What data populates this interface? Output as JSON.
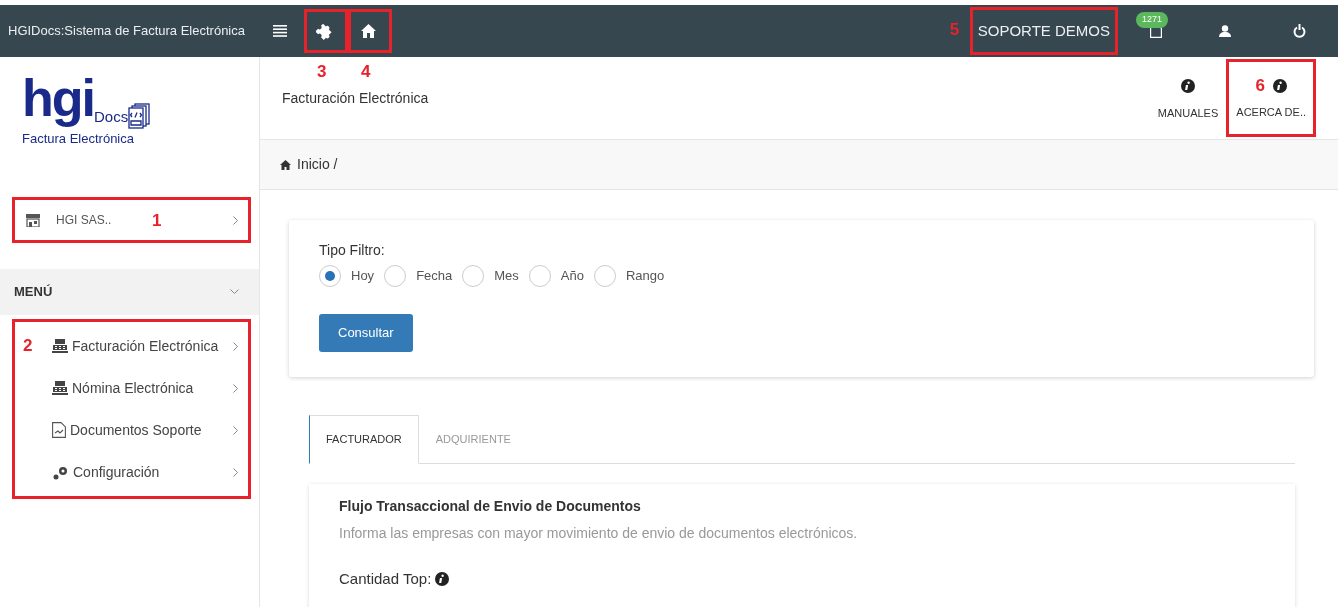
{
  "topbar": {
    "title": "HGIDocs:Sistema de Factura Electrónica",
    "tools": [
      {
        "kind": "menu"
      },
      {
        "kind": "puzzle",
        "callout": "3"
      },
      {
        "kind": "home",
        "callout": "4"
      }
    ],
    "user_name": {
      "text": "SOPORTE DEMOS",
      "callout": "5"
    },
    "notifications": {
      "count": "1271"
    },
    "actions": [
      {
        "kind": "user"
      },
      {
        "kind": "power"
      }
    ]
  },
  "sidebar": {
    "logo": {
      "word": "hgi",
      "suffix": "Docs",
      "tagline": "Factura Electrónica"
    },
    "company": {
      "name": "HGI SAS..",
      "callout": "1"
    },
    "menu": {
      "title": "MENÚ",
      "expanded": true,
      "callout": "2",
      "items": [
        {
          "label": "Facturación Electrónica",
          "kind": "register"
        },
        {
          "label": "Nómina Electrónica",
          "kind": "register"
        },
        {
          "label": "Documentos Soporte",
          "kind": "document"
        },
        {
          "label": "Configuración",
          "kind": "gears"
        }
      ]
    }
  },
  "header": {
    "title": "Facturación Electrónica",
    "links": [
      {
        "label": "MANUALES"
      },
      {
        "label": "ACERCA DE..",
        "callout": "6"
      }
    ]
  },
  "breadcrumb": "Inicio /",
  "filter": {
    "label": "Tipo Filtro:",
    "options": [
      {
        "label": "Hoy",
        "selected": true
      },
      {
        "label": "Fecha",
        "selected": false
      },
      {
        "label": "Mes",
        "selected": false
      },
      {
        "label": "Año",
        "selected": false
      },
      {
        "label": "Rango",
        "selected": false
      }
    ],
    "button": "Consultar"
  },
  "tabs": [
    {
      "label": "FACTURADOR",
      "selected": true
    },
    {
      "label": "ADQUIRIENTE",
      "selected": false
    }
  ],
  "panel": {
    "title": "Flujo Transaccional de Envio de Documentos",
    "subtitle": "Informa las empresas con mayor movimiento de envio de documentos electrónicos.",
    "field_label": "Cantidad Top:"
  }
}
